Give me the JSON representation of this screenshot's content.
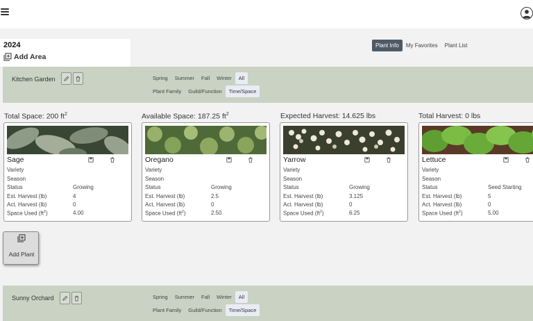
{
  "header": {
    "menu_icon": "hamburger-icon",
    "account_icon": "account-circle-icon"
  },
  "season": {
    "year": "2024",
    "add_area_label": "Add Area"
  },
  "view_tabs": [
    {
      "label": "Plant Info",
      "active": true
    },
    {
      "label": "My Favorites",
      "active": false
    },
    {
      "label": "Plant List",
      "active": false
    }
  ],
  "areas": [
    {
      "name": "Kitchen Garden",
      "season_filters": [
        "Spring",
        "Summer",
        "Fall",
        "Winter",
        "All"
      ],
      "season_selected": "All",
      "info_filters": [
        "Plant Family",
        "Guild/Function",
        "Time/Space"
      ],
      "info_selected": "Time/Space"
    },
    {
      "name": "Sunny Orchard",
      "season_filters": [
        "Spring",
        "Summer",
        "Fall",
        "Winter",
        "All"
      ],
      "season_selected": "All",
      "info_filters": [
        "Plant Family",
        "Guild/Function",
        "Time/Space"
      ],
      "info_selected": "Time/Space"
    }
  ],
  "stats": {
    "total_space": "Total Space: 200 ft",
    "available_space": "Available Space: 187.25 ft",
    "area_unit_exp": "2",
    "expected_harvest": "Expected Harvest: 14.625 lbs",
    "total_harvest": "Total Harvest: 0 lbs"
  },
  "field_labels": {
    "variety": "Variety",
    "season": "Season",
    "status": "Status",
    "est_harvest": "Est. Harvest (lb)",
    "act_harvest": "Act. Harvest (lb)",
    "space_used": "Space Used (ft",
    "space_used_end": ")",
    "exp": "2"
  },
  "plants": [
    {
      "name": "Sage",
      "status": "Growing",
      "est_harvest": "4",
      "act_harvest": "0",
      "space_used": "4.00"
    },
    {
      "name": "Oregano",
      "status": "Growing",
      "est_harvest": "2.5",
      "act_harvest": "0",
      "space_used": "2.50"
    },
    {
      "name": "Yarrow",
      "status": "Growing",
      "est_harvest": "3.125",
      "act_harvest": "0",
      "space_used": "6.25"
    },
    {
      "name": "Lettuce",
      "status": "Seed Starting",
      "est_harvest": "5",
      "act_harvest": "0",
      "space_used": "5.00"
    }
  ],
  "add_plant_label": "Add Plant",
  "colors": {
    "area_band": "#c9d2c3",
    "active_tab": "#4e5a65",
    "active_chip": "#e9ecf4"
  }
}
